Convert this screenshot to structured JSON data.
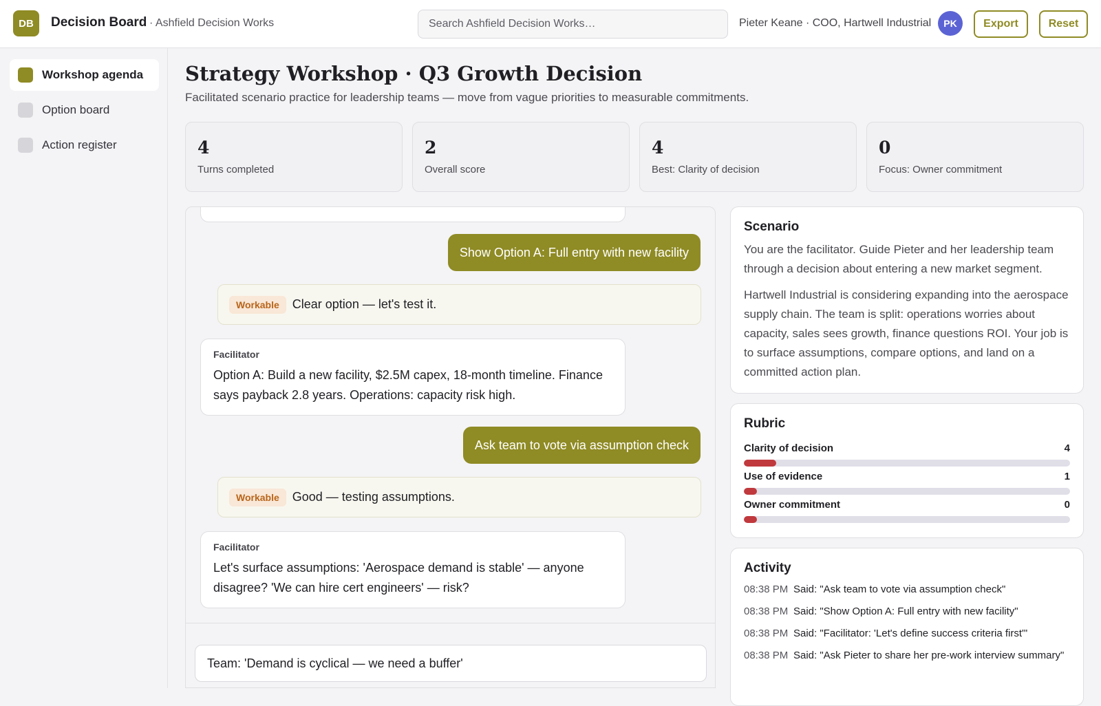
{
  "header": {
    "logo_initials": "DB",
    "app_title": "Decision Board",
    "workspace": "· Ashfield Decision Works",
    "search_placeholder": "Search Ashfield Decision Works…",
    "user_name": "Pieter Keane · COO, Hartwell Industrial",
    "user_initials": "PK",
    "export_label": "Export",
    "reset_label": "Reset",
    "accent_color": "#8f8b25",
    "avatar_color": "#5b63d4"
  },
  "sidebar": {
    "items": [
      {
        "label": "Workshop agenda",
        "active": true
      },
      {
        "label": "Option board",
        "active": false
      },
      {
        "label": "Action register",
        "active": false
      }
    ]
  },
  "main": {
    "title": "Strategy Workshop · Q3 Growth Decision",
    "subtitle": "Facilitated scenario practice for leadership teams — move from vague priorities to measurable commitments."
  },
  "stats": [
    {
      "value": "4",
      "label": "Turns completed"
    },
    {
      "value": "2",
      "label": "Overall score"
    },
    {
      "value": "4",
      "label": "Best: Clarity of decision"
    },
    {
      "value": "0",
      "label": "Focus: Owner commitment"
    }
  ],
  "chat": {
    "messages": [
      {
        "type": "user",
        "text": "Show Option A: Full entry with new facility"
      },
      {
        "type": "feedback",
        "badge": "Workable",
        "text": "Clear option — let's test it."
      },
      {
        "type": "facilitator",
        "label": "Facilitator",
        "text": "Option A: Build a new facility, $2.5M capex, 18-month timeline. Finance says payback 2.8 years. Operations: capacity risk high."
      },
      {
        "type": "user",
        "text": "Ask team to vote via assumption check"
      },
      {
        "type": "feedback",
        "badge": "Workable",
        "text": "Good — testing assumptions."
      },
      {
        "type": "facilitator",
        "label": "Facilitator",
        "text": "Let's surface assumptions: 'Aerospace demand is stable' — anyone disagree? 'We can hire cert engineers' — risk?"
      }
    ],
    "composer_value": "Team: 'Demand is cyclical — we need a buffer'"
  },
  "scenario": {
    "title": "Scenario",
    "p1": "You are the facilitator. Guide Pieter and her leadership team through a decision about entering a new market segment.",
    "p2": "Hartwell Industrial is considering expanding into the aerospace supply chain. The team is split: operations worries about capacity, sales sees growth, finance questions ROI. Your job is to surface assumptions, compare options, and land on a committed action plan."
  },
  "rubric": {
    "title": "Rubric",
    "items": [
      {
        "label": "Clarity of decision",
        "score": "4",
        "fill_pct": 10
      },
      {
        "label": "Use of evidence",
        "score": "1",
        "fill_pct": 4
      },
      {
        "label": "Owner commitment",
        "score": "0",
        "fill_pct": 4
      }
    ],
    "bar_color": "#c0393d"
  },
  "activity": {
    "title": "Activity",
    "items": [
      {
        "time": "08:38 PM",
        "text": "Said: \"Ask team to vote via assumption check\""
      },
      {
        "time": "08:38 PM",
        "text": "Said: \"Show Option A: Full entry with new facility\""
      },
      {
        "time": "08:38 PM",
        "text": "Said: \"Facilitator: 'Let's define success criteria first'\""
      },
      {
        "time": "08:38 PM",
        "text": "Said: \"Ask Pieter to share her pre-work interview summary\""
      }
    ]
  }
}
